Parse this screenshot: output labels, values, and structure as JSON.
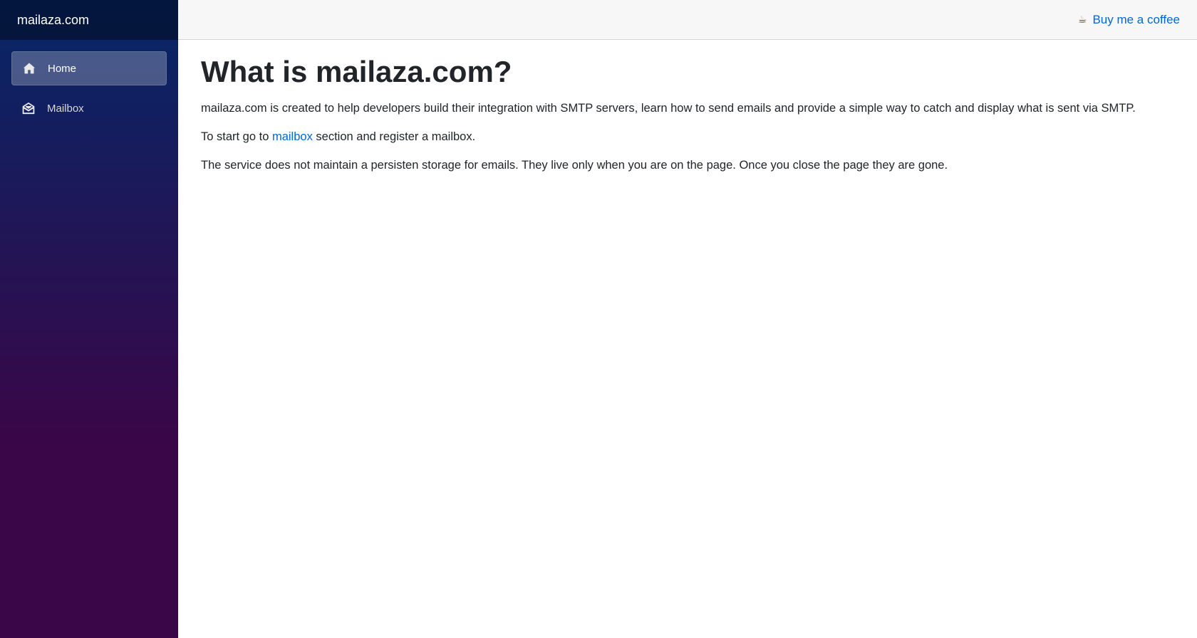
{
  "sidebar": {
    "brand": "mailaza.com",
    "items": [
      {
        "label": "Home",
        "icon": "home-icon",
        "active": true
      },
      {
        "label": "Mailbox",
        "icon": "mailbox-icon",
        "active": false
      }
    ]
  },
  "header": {
    "coffee_icon": "☕",
    "coffee_label": "Buy me a coffee"
  },
  "main": {
    "title": "What is mailaza.com?",
    "intro": "mailaza.com is created to help developers build their integration with SMTP servers, learn how to send emails and provide a simple way to catch and display what is sent via SMTP.",
    "start_prefix": "To start go to ",
    "start_link": "mailbox",
    "start_suffix": " section and register a mailbox.",
    "storage_note": "The service does not maintain a persisten storage for emails. They live only when you are on the page. Once you close the page they are gone."
  },
  "colors": {
    "link": "#0366d6",
    "sidebar_top": "#052767",
    "sidebar_bottom": "#3a0647"
  }
}
